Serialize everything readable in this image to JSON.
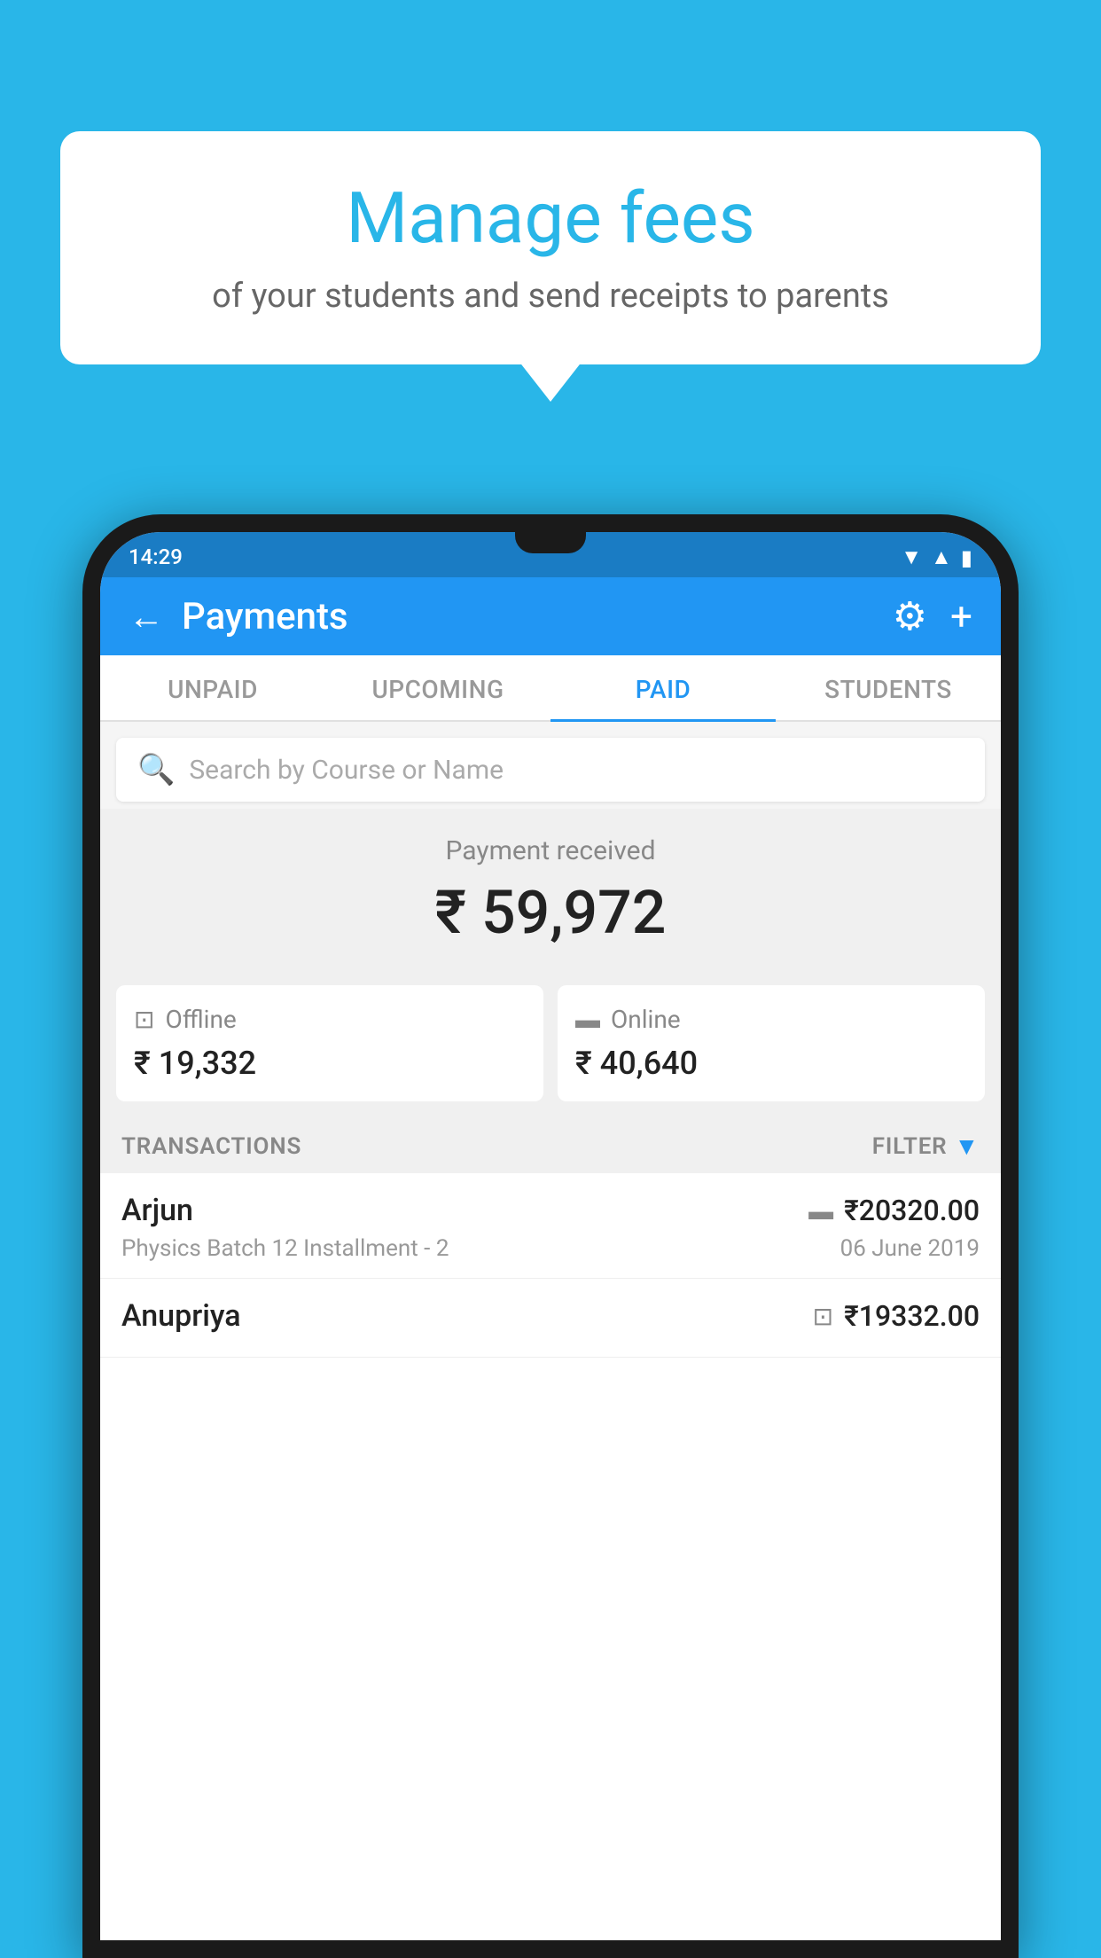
{
  "background_color": "#29b6e8",
  "speech_bubble": {
    "title": "Manage fees",
    "subtitle": "of your students and send receipts to parents"
  },
  "phone": {
    "status_bar": {
      "time": "14:29",
      "wifi": "▼",
      "signal": "▲",
      "battery": "▮"
    },
    "header": {
      "title": "Payments",
      "back_icon": "←",
      "settings_icon": "⚙",
      "add_icon": "+"
    },
    "tabs": [
      {
        "label": "UNPAID",
        "active": false
      },
      {
        "label": "UPCOMING",
        "active": false
      },
      {
        "label": "PAID",
        "active": true
      },
      {
        "label": "STUDENTS",
        "active": false
      }
    ],
    "search": {
      "placeholder": "Search by Course or Name",
      "search_icon": "🔍"
    },
    "payment_received": {
      "label": "Payment received",
      "amount": "₹ 59,972"
    },
    "payment_cards": [
      {
        "icon": "offline",
        "label": "Offline",
        "amount": "₹ 19,332"
      },
      {
        "icon": "online",
        "label": "Online",
        "amount": "₹ 40,640"
      }
    ],
    "transactions_header": {
      "label": "TRANSACTIONS",
      "filter_label": "FILTER"
    },
    "transactions": [
      {
        "name": "Arjun",
        "course": "Physics Batch 12 Installment - 2",
        "amount": "₹20320.00",
        "date": "06 June 2019",
        "payment_type": "online"
      },
      {
        "name": "Anupriya",
        "course": "",
        "amount": "₹19332.00",
        "date": "",
        "payment_type": "offline"
      }
    ]
  }
}
